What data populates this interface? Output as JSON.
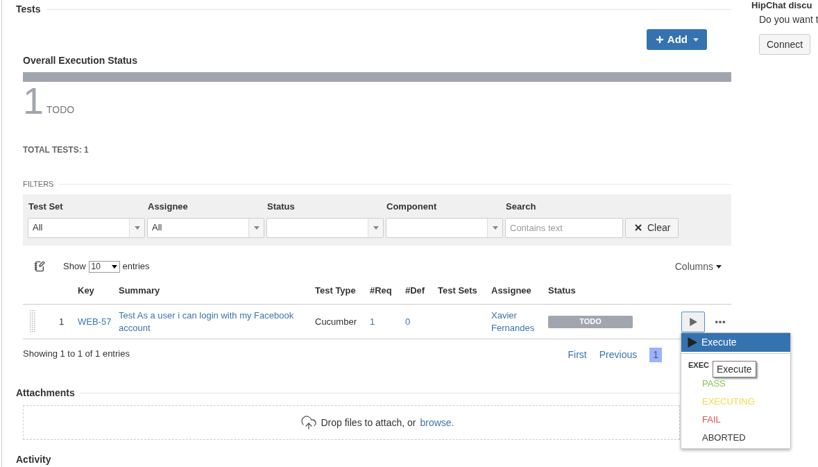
{
  "sidebar": {
    "title": "HipChat discu",
    "text": "Do you want t",
    "button": "Connect"
  },
  "section_title": "Tests",
  "add_button": "Add",
  "overall": {
    "title": "Overall Execution Status",
    "segments": [
      {
        "level": 1,
        "color": "#a1a5ae"
      }
    ],
    "count": "1",
    "count_label": "TODO"
  },
  "total_tests": "TOTAL TESTS: 1",
  "filters": {
    "title": "FILTERS",
    "fields": [
      {
        "kind": "select",
        "label": "Test Set",
        "value": "All"
      },
      {
        "kind": "select",
        "label": "Assignee",
        "value": "All"
      },
      {
        "kind": "select",
        "label": "Status"
      },
      {
        "kind": "select",
        "label": "Component"
      },
      {
        "kind": "text",
        "label": "Search",
        "placeholder": "Contains text"
      }
    ],
    "clear_button": "Clear"
  },
  "table_toolbar": {
    "show": "Show",
    "page_size": "10",
    "entries": "entries",
    "columns_button": "Columns"
  },
  "table": {
    "columns": [
      "Key",
      "Summary",
      "Test Type",
      "#Req",
      "#Def",
      "Test Sets",
      "Assignee",
      "Status"
    ],
    "rows": [
      {
        "rank": "1",
        "key": "WEB-57",
        "summary": "Test As a user i can login with my Facebook account",
        "test_type": "Cucumber",
        "req": "1",
        "def": "0",
        "assignee": "Xavier Fernandes",
        "status": "TODO"
      }
    ]
  },
  "info": "Showing 1 to 1 of 1 entries",
  "pagination": [
    {
      "label": "First",
      "selected": false
    },
    {
      "label": "Previous",
      "selected": false
    },
    {
      "label": "1",
      "selected": true
    }
  ],
  "attachments": {
    "title": "Attachments",
    "drop_text": "Drop files to attach, or",
    "browse_link": "browse."
  },
  "activity_title": "Activity",
  "action_menu": {
    "items": [
      {
        "kind": "action",
        "label": "Execute",
        "selected": true
      },
      {
        "kind": "header",
        "label": "EXEC"
      },
      {
        "kind": "status",
        "label": "PASS",
        "color": "#8cc152"
      },
      {
        "kind": "status",
        "label": "EXECUTING",
        "color": "#f2d94e"
      },
      {
        "kind": "status",
        "label": "FAIL",
        "color": "#d9534f"
      },
      {
        "kind": "status",
        "label": "ABORTED",
        "color": "#333333"
      }
    ]
  },
  "tooltip": "Execute"
}
